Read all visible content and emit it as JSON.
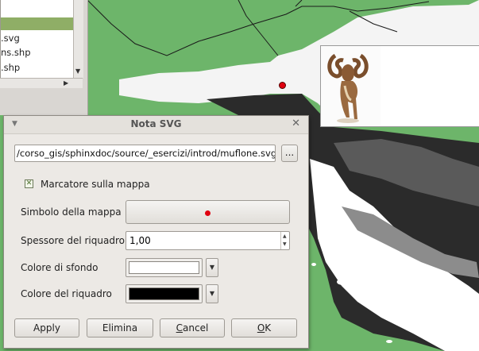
{
  "file_list": {
    "items": [
      ".svg",
      "ns.shp",
      ".shp"
    ]
  },
  "dialog": {
    "title": "Nota SVG",
    "file_path": "/corso_gis/sphinxdoc/source/_esercizi/introd/muflone.svg",
    "browse_label": "...",
    "map_marker_label": "Marcatore sulla mappa",
    "map_marker_checked": true,
    "map_symbol_label": "Simbolo della mappa",
    "frame_width_label": "Spessore del riquadro",
    "frame_width_value": "1,00",
    "background_color_label": "Colore di sfondo",
    "background_color": "#ffffff",
    "frame_color_label": "Colore del riquadro",
    "frame_color": "#000000",
    "buttons": {
      "apply": "Apply",
      "delete": "Elimina",
      "cancel_rest": "ancel",
      "cancel_mnemonic": "C",
      "ok_rest": "K",
      "ok_mnemonic": "O"
    }
  },
  "colors": {
    "land": "#6db56a",
    "marker": "#e00010",
    "selection": "#8fae66"
  }
}
